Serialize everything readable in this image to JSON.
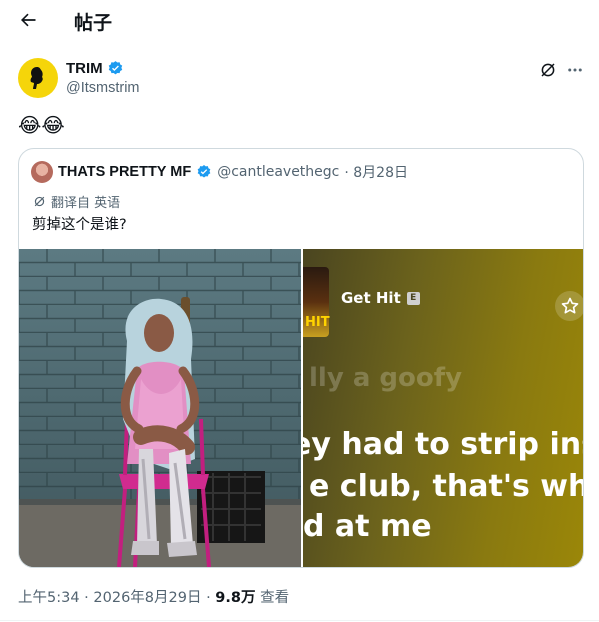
{
  "header": {
    "back_icon": "arrow-left-icon",
    "title": "帖子"
  },
  "tweet": {
    "author": {
      "name": "TRIM",
      "handle": "@Itsmstrim",
      "verified": true,
      "avatar_color": "#f5d50a"
    },
    "text": "😂😂",
    "actions": {
      "grok_icon": "grok-icon",
      "more_icon": "more-horizontal-icon"
    },
    "quote": {
      "author": {
        "name": "THATS PRETTY MF",
        "handle": "@cantleavethegc",
        "verified": true
      },
      "date": "· 8月28日",
      "translated_from": "翻译自 英语",
      "text": "剪掉这个是谁?",
      "media": {
        "right": {
          "thumb_text": "HIT",
          "song_title": "Get Hit",
          "explicit_badge": "E",
          "star_icon": "star-outline-icon",
          "lyrics": [
            "lly a goofy",
            "ey had to strip insid",
            "e club, that's why th",
            "d at me"
          ]
        }
      }
    },
    "meta": {
      "time": "上午5:34 · 2026年8月29日 · ",
      "views_count": "9.8万",
      "views_label": " 查看"
    }
  },
  "colors": {
    "verified_blue": "#1d9bf0",
    "secondary_text": "#536471",
    "border": "#cfd9de"
  }
}
